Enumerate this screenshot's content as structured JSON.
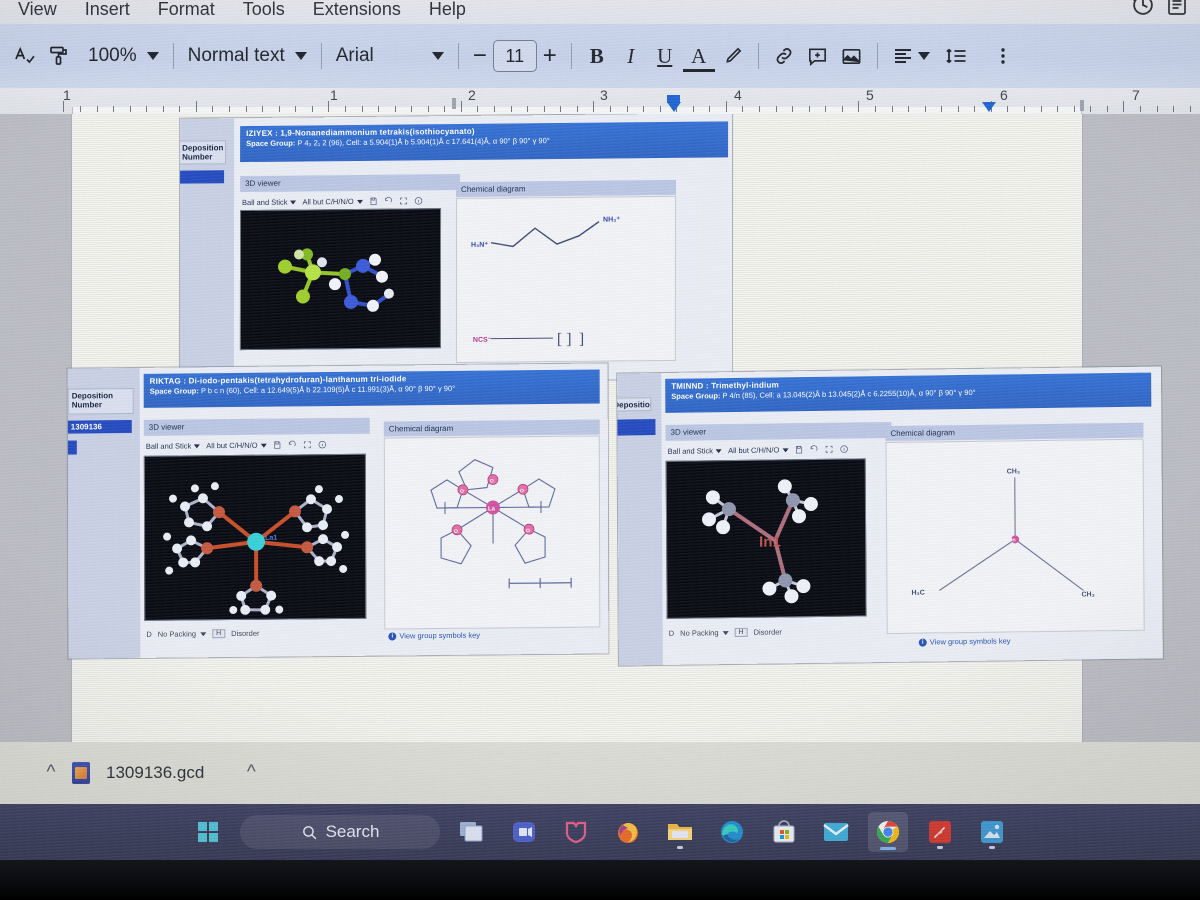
{
  "app": {
    "name": "Google Docs",
    "menu": [
      "View",
      "Insert",
      "Format",
      "Tools",
      "Extensions",
      "Help"
    ],
    "top_right_icons": [
      "history-clock-icon",
      "document-outline-icon"
    ]
  },
  "toolbar": {
    "spelling_icon": "spellcheck-icon",
    "paint_format_icon": "paint-format-icon",
    "zoom_value": "100%",
    "style_value": "Normal text",
    "font_value": "Arial",
    "font_size_value": "11",
    "decrease_font_label": "−",
    "increase_font_label": "+",
    "bold_label": "B",
    "italic_label": "I",
    "underline_label": "U",
    "text_color_label": "A",
    "highlight_icon": "highlighter-pen-icon",
    "link_icon": "insert-link-icon",
    "comment_icon": "add-comment-icon",
    "image_icon": "insert-image-icon",
    "align_icon": "align-left-icon",
    "line_spacing_icon": "line-spacing-icon",
    "more_icon": "more-options-icon"
  },
  "ruler": {
    "numbers": [
      "1",
      "1",
      "2",
      "3",
      "4",
      "5",
      "6",
      "7"
    ],
    "left_indent_marker": "left-indent-marker",
    "right_indent_marker": "right-indent-marker"
  },
  "screenshots": [
    {
      "id": "shot-1",
      "title": "IZIYEX : 1,9-Nonanediammonium tetrakis(isothiocyanato)",
      "space_group_label": "Space Group:",
      "space_group_value": "P 4₃ 2₁ 2 (96), Cell: a 5.904(1)Å b 5.904(1)Å c 17.641(4)Å, α 90° β 90° γ 90°",
      "viewer_header": "3D viewer",
      "style_dropdown": "Ball and Stick",
      "atoms_dropdown": "All but C/H/N/O",
      "viewer_icons": [
        "save-icon",
        "reset-rotation-icon",
        "fullscreen-icon",
        "info-icon"
      ],
      "diagram_header": "Chemical diagram",
      "diagram_labels": [
        "H₃N⁺",
        "NH₃⁺",
        "NCS⁻"
      ],
      "sidebar_label": "Deposition\nNumber"
    },
    {
      "id": "shot-2",
      "title": "RIKTAG : Di-iodo-pentakis(tetrahydrofuran)-lanthanum tri-iodide",
      "space_group_label": "Space Group:",
      "space_group_value": "P b c n (60), Cell: a 12.649(5)Å b 22.109(5)Å c 11.991(3)Å, α 90° β 90° γ 90°",
      "viewer_header": "3D viewer",
      "style_dropdown": "Ball and Stick",
      "atoms_dropdown": "All but C/H/N/O",
      "viewer_icons": [
        "save-icon",
        "reset-rotation-icon",
        "fullscreen-icon",
        "info-icon"
      ],
      "diagram_header": "Chemical diagram",
      "packing_dropdown": "No Packing",
      "disorder_button": "Disorder",
      "packing_prefix": "D",
      "disorder_prefix": "H",
      "key_link": "View group symbols key",
      "center_atom": "La",
      "ligand_atoms": [
        "O",
        "O",
        "O",
        "O",
        "O"
      ],
      "sidebar_label": "Deposition\nNumber",
      "sidebar_value": "1309136"
    },
    {
      "id": "shot-3",
      "title": "TMINND : Trimethyl-indium",
      "space_group_label": "Space Group:",
      "space_group_value": "P 4/n (85), Cell: a 13.045(2)Å b 13.045(2)Å c 6.2255(10)Å, α 90° β 90° γ 90°",
      "viewer_header": "3D viewer",
      "style_dropdown": "Ball and Stick",
      "atoms_dropdown": "All but C/H/N/O",
      "viewer_icons": [
        "save-icon",
        "reset-rotation-icon",
        "fullscreen-icon",
        "info-icon"
      ],
      "diagram_header": "Chemical diagram",
      "packing_dropdown": "No Packing",
      "disorder_button": "Disorder",
      "packing_prefix": "D",
      "disorder_prefix": "H",
      "key_link": "View group symbols key",
      "center_atom": "In",
      "viewer_atom_label": "In1",
      "diagram_labels": [
        "CH₃",
        "H₃C",
        "CH₃"
      ],
      "sidebar_label": "Deposition"
    }
  ],
  "download_bar": {
    "left_chevron": "chevron-up-icon",
    "file_name": "1309136.gcd",
    "right_chevron": "chevron-up-icon",
    "file_icon": "gcd-file-icon"
  },
  "taskbar": {
    "start_icon": "windows-start-icon",
    "search_label": "Search",
    "search_icon": "search-icon",
    "items": [
      "task-view-icon",
      "teams-icon",
      "security-icon",
      "firefox-icon",
      "file-explorer-icon",
      "edge-icon",
      "microsoft-store-icon",
      "mail-icon",
      "chrome-icon",
      "avast-icon",
      "photos-icon"
    ]
  },
  "colors": {
    "toolbar_bg": "#c4d1ea",
    "title_blue": "#2f6fd8",
    "sidebar_blue": "#1f47c4",
    "link_blue": "#2050b8",
    "taskbar_bg": "#3b3f62",
    "page_bg": "#ececE6",
    "viewer_bg": "#04060e"
  }
}
